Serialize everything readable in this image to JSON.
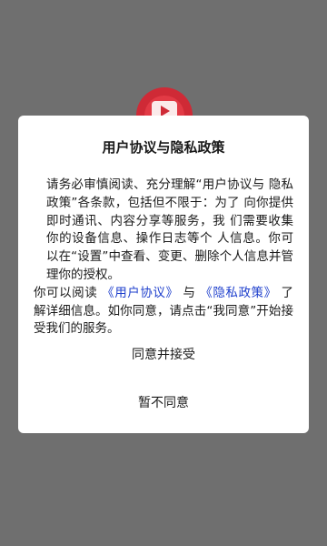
{
  "app": {
    "logo_icon": "red-circular-tv-play-logo-icon",
    "colors": {
      "backdrop": "#6f6f6f",
      "logo_red": "#cf2a36",
      "link_blue": "#1e3fcc"
    }
  },
  "dialog": {
    "title": "用户协议与隐私政策",
    "paragraph1": "请务必审慎阅读、充分理解“用户协议与 隐私政策”各条款，包括但不限于：为了 向你提供即时通讯、内容分享等服务，我 们需要收集你的设备信息、操作日志等个 人信息。你可以在“设置”中查看、变更、删除个人信息并管理你的授权。",
    "paragraph2_lead": "你可以阅读 ",
    "user_agreement_link": "《用户协议》",
    "paragraph2_mid": " 与 ",
    "privacy_policy_link": "《隐私政策》",
    "paragraph2_tail": " 了解详细信息。如你同意，请点击“我同意”开始接受我们的服务。",
    "agree_button": "同意并接受",
    "decline_button": "暂不同意"
  }
}
